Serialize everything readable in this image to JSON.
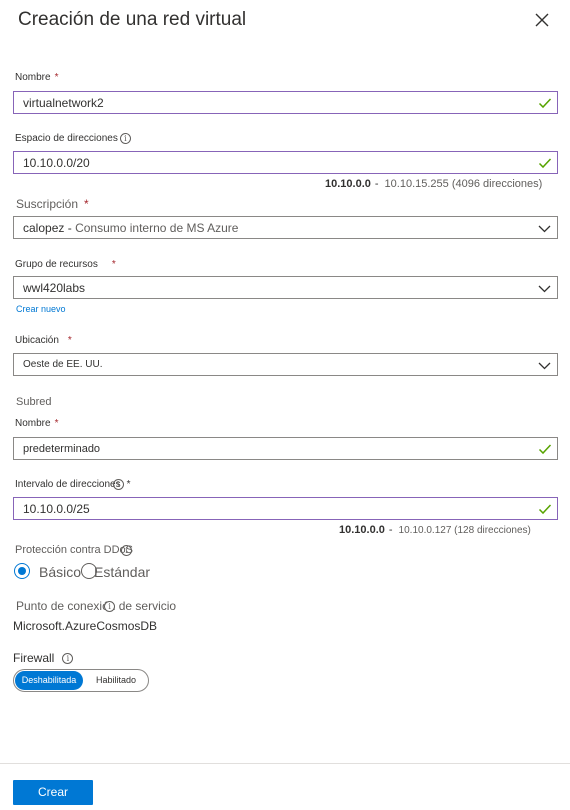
{
  "header": {
    "title": "Creación de una red virtual",
    "close_icon": "close-icon"
  },
  "name": {
    "label": "Nombre",
    "value": "virtualnetwork2"
  },
  "address_space": {
    "label": "Espacio de direcciones",
    "value": "10.10.0.0/20",
    "range_start": "10.10.0.0",
    "range_dash": "-",
    "range_end": "10.10.15.255 (4096 direcciones)"
  },
  "subscription": {
    "label": "Suscripción",
    "value": "calopez",
    "dash": "-",
    "detail": "Consumo interno de MS Azure"
  },
  "resource_group": {
    "label": "Grupo de recursos",
    "value": "wwl420labs",
    "create_new": "Crear nuevo"
  },
  "location": {
    "label": "Ubicación",
    "value": "Oeste de EE. UU."
  },
  "subnet": {
    "heading": "Subred",
    "name_label": "Nombre",
    "name_value": "predeterminado",
    "range_label": "Intervalo de direcciones",
    "range_value": "10.10.0.0/25",
    "range_start": "10.10.0.0",
    "range_dash": "-",
    "range_end": "10.10.0.127 (128 direcciones)"
  },
  "ddos": {
    "label": "Protección contra DDoS",
    "option_basic": "Básico",
    "option_standard": "Estándar",
    "selected": "Básico"
  },
  "service_endpoint": {
    "label": "Punto de conexión de servicio",
    "value": "Microsoft.AzureCosmosDB"
  },
  "firewall": {
    "label": "Firewall",
    "option_disabled": "Deshabilitada",
    "option_enabled": "Habilitado",
    "selected": "Deshabilitada"
  },
  "footer": {
    "create_button": "Crear"
  },
  "colors": {
    "accent": "#0078d4",
    "valid_border": "#8764b8",
    "valid_check": "#57a300",
    "required": "#a4262c"
  }
}
